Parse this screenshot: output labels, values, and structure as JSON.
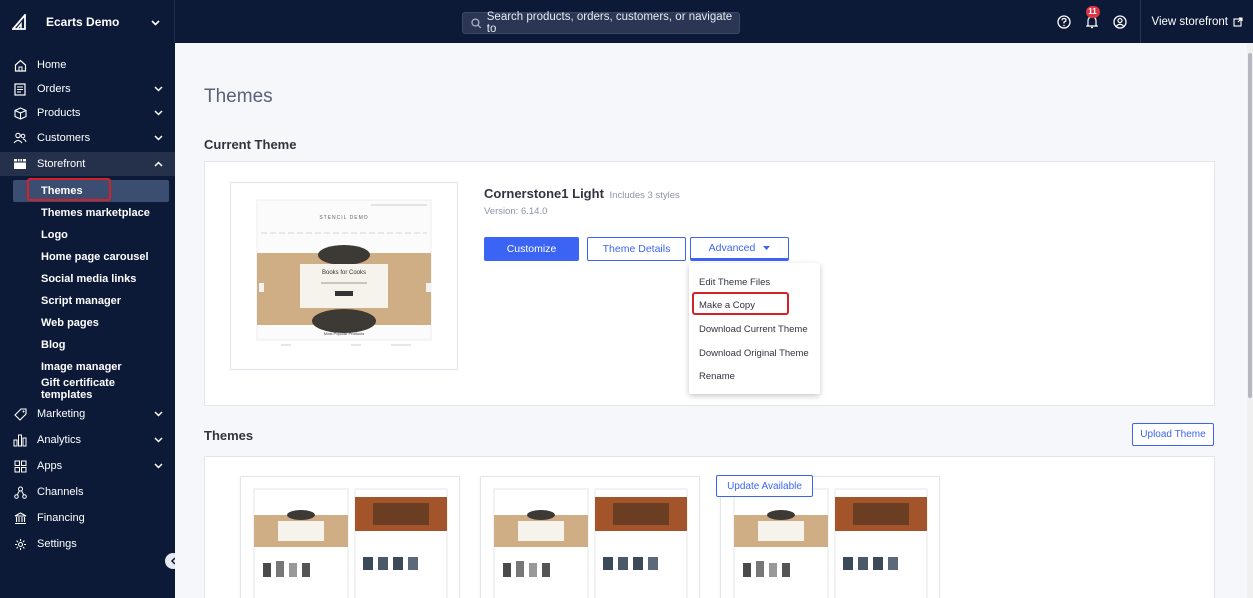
{
  "topbar": {
    "store_name": "Ecarts Demo",
    "search_placeholder": "Search products, orders, customers, or navigate to",
    "notifications_count": "11",
    "view_storefront": "View storefront"
  },
  "sidebar": {
    "items": [
      {
        "label": "Home",
        "icon": "home-icon"
      },
      {
        "label": "Orders",
        "icon": "orders-icon"
      },
      {
        "label": "Products",
        "icon": "products-icon"
      },
      {
        "label": "Customers",
        "icon": "customers-icon"
      },
      {
        "label": "Storefront",
        "icon": "storefront-icon"
      },
      {
        "label": "Marketing",
        "icon": "marketing-icon"
      },
      {
        "label": "Analytics",
        "icon": "analytics-icon"
      },
      {
        "label": "Apps",
        "icon": "apps-icon"
      },
      {
        "label": "Channels",
        "icon": "channels-icon"
      },
      {
        "label": "Financing",
        "icon": "financing-icon"
      },
      {
        "label": "Settings",
        "icon": "settings-icon"
      }
    ],
    "storefront_sub": [
      "Themes",
      "Themes marketplace",
      "Logo",
      "Home page carousel",
      "Social media links",
      "Script manager",
      "Web pages",
      "Blog",
      "Image manager",
      "Gift certificate templates"
    ]
  },
  "main": {
    "page_title": "Themes",
    "current_theme_heading": "Current Theme",
    "theme": {
      "name": "Cornerstone1 Light",
      "styles": "Includes 3 styles",
      "version": "Version: 6.14.0",
      "thumb_store": "STENCIL DEMO",
      "thumb_banner": "Books for Cooks",
      "thumb_section": "Most Popular Products"
    },
    "buttons": {
      "customize": "Customize",
      "details": "Theme Details",
      "advanced": "Advanced"
    },
    "advanced_menu": [
      "Edit Theme Files",
      "Make a Copy",
      "Download Current Theme",
      "Download Original Theme",
      "Rename"
    ],
    "themes_heading": "Themes",
    "upload_theme": "Upload Theme",
    "update_available": "Update Available"
  },
  "colors": {
    "nav_bg": "#0c1a38",
    "primary": "#3c64f4",
    "highlight": "#d42127"
  }
}
